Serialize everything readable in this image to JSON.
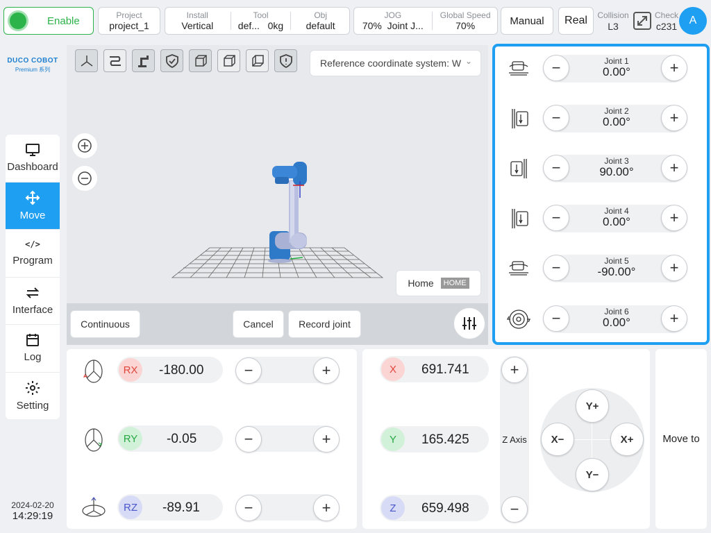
{
  "topbar": {
    "enable_label": "Enable",
    "project": {
      "label": "Project",
      "value": "project_1"
    },
    "install": {
      "label": "Install",
      "value": "Vertical"
    },
    "tool": {
      "label": "Tool",
      "value": "def...",
      "weight": "0kg"
    },
    "obj": {
      "label": "Obj",
      "value": "default"
    },
    "jog": {
      "label": "JOG",
      "value": "70%",
      "mode": "Joint J..."
    },
    "global_speed": {
      "label": "Global Speed",
      "value": "70%"
    },
    "mode_button": "Manual",
    "real_button": "Real",
    "collision": {
      "label": "Collision",
      "value": "L3"
    },
    "check": {
      "label": "Check",
      "value": "c231"
    },
    "avatar_letter": "A"
  },
  "brand": {
    "name": "DUCO COBOT",
    "sub": "Premium 系列"
  },
  "sidebar": {
    "items": [
      {
        "label": "Dashboard",
        "icon": "monitor-icon"
      },
      {
        "label": "Move",
        "icon": "move-arrows-icon"
      },
      {
        "label": "Program",
        "icon": "code-icon"
      },
      {
        "label": "Interface",
        "icon": "swap-arrows-icon"
      },
      {
        "label": "Log",
        "icon": "calendar-icon"
      },
      {
        "label": "Setting",
        "icon": "gear-icon"
      }
    ],
    "active": "Move"
  },
  "datetime": {
    "date": "2024-02-20",
    "time": "14:29:19"
  },
  "viewport": {
    "ref_coord": "Reference coordinate system: W",
    "home_label": "Home",
    "home_tag": "HOME",
    "continuous_label": "Continuous",
    "cancel_label": "Cancel",
    "record_label": "Record joint"
  },
  "joints": [
    {
      "name": "Joint 1",
      "value": "0.00°"
    },
    {
      "name": "Joint 2",
      "value": "0.00°"
    },
    {
      "name": "Joint 3",
      "value": "90.00°"
    },
    {
      "name": "Joint 4",
      "value": "0.00°"
    },
    {
      "name": "Joint 5",
      "value": "-90.00°"
    },
    {
      "name": "Joint 6",
      "value": "0.00°"
    }
  ],
  "rotation": [
    {
      "axis": "RX",
      "value": "-180.00",
      "color": "#e0463c"
    },
    {
      "axis": "RY",
      "value": "-0.05",
      "color": "#27a844"
    },
    {
      "axis": "RZ",
      "value": "-89.91",
      "color": "#4a56c8"
    }
  ],
  "position": [
    {
      "axis": "X",
      "value": "691.741",
      "color": "#e0463c"
    },
    {
      "axis": "Y",
      "value": "165.425",
      "color": "#27a844"
    },
    {
      "axis": "Z",
      "value": "659.498",
      "color": "#4a56c8"
    }
  ],
  "z_axis_label": "Z Axis",
  "pad": {
    "up": "Y+",
    "down": "Y−",
    "left": "X−",
    "right": "X+"
  },
  "move_to_label": "Move to",
  "colors": {
    "accent": "#1e9ff2",
    "enable": "#2cb34a"
  }
}
